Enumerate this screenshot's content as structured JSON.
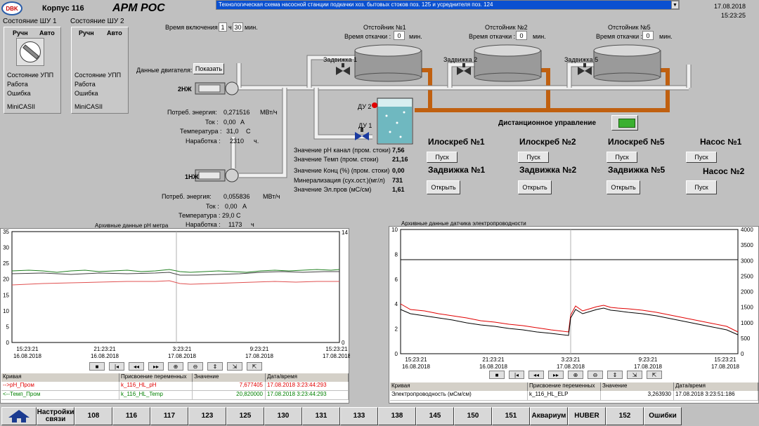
{
  "header": {
    "logo_text": "DBK",
    "building": "Корпус 116",
    "app_title": "АРМ РОС",
    "scheme_title": "Технологическая схема насосной станции подкачки хоз. бытовых стоков поз. 125 и усреднителя поз. 124",
    "date": "17.08.2018",
    "time": "15:23:25"
  },
  "shu1": {
    "title": "Состояние ШУ 1",
    "manual": "Ручн",
    "auto": "Авто",
    "upp": "Состояние УПП",
    "work": "Работа",
    "error": "Ошибка",
    "device": "MiniCASII"
  },
  "shu2": {
    "title": "Состояние ШУ 2",
    "manual": "Ручн",
    "auto": "Авто",
    "upp": "Состояние УПП",
    "work": "Работа",
    "error": "Ошибка",
    "device": "MiniCASII"
  },
  "schedule": {
    "label": "Время включения :",
    "hours": "1",
    "h": "ч",
    "minutes": "30",
    "min": "мин."
  },
  "motors": {
    "label": "Данные двигателя:",
    "show": "Показать"
  },
  "pump2": {
    "name": "2НЖ",
    "energy_label": "Потреб. энергия:",
    "energy": "0,271516",
    "energy_unit": "МВт/ч",
    "current_label": "Ток :",
    "current": "0,00",
    "current_unit": "А",
    "temp_label": "Температура :",
    "temp": "31,0",
    "temp_unit": "С",
    "hours_label": "Наработка :",
    "hours": "2310",
    "hours_unit": "ч."
  },
  "pump1": {
    "name": "1НЖ",
    "energy_label": "Потреб. энергия:",
    "energy": "0,055836",
    "energy_unit": "МВт/ч",
    "current_label": "Ток :",
    "current": "0,00",
    "current_unit": "А",
    "temp_label": "Температура :",
    "temp": "29,0",
    "temp_unit": "С",
    "hours_label": "Наработка :",
    "hours": "1173",
    "hours_unit": "ч"
  },
  "settlers": [
    {
      "title": "Отстойник №1",
      "pump_label": "Время откачки :",
      "value": "0",
      "unit": "мин.",
      "valve": "Задвижка 1"
    },
    {
      "title": "Отстойник №2",
      "pump_label": "Время откачки :",
      "value": "0",
      "unit": "мин.",
      "valve": "Задвижка 2"
    },
    {
      "title": "Отстойник №5",
      "pump_label": "Время откачки :",
      "value": "0",
      "unit": "мин.",
      "valve": "Задвижка 5"
    }
  ],
  "sensors": {
    "du2": "ДУ 2",
    "du1": "ДУ 1"
  },
  "remote": {
    "label": "Дистанционное управление"
  },
  "measurements": [
    {
      "label": "Значение pH канал (пром. стоки)",
      "value": "7,56"
    },
    {
      "label": "Значение Темп (пром. стоки)",
      "value": "21,16"
    },
    {
      "label": "Значение Конц (%) (пром. стоки)",
      "value": "0,00"
    },
    {
      "label": "Минерализация (сух.ост.)(мг/л)",
      "value": "731"
    },
    {
      "label": "Значение Эл.пров (мС/см)",
      "value": "1,61"
    }
  ],
  "controls": {
    "ilo1": "Илоскреб №1",
    "ilo2": "Илоскреб №2",
    "ilo5": "Илоскреб №5",
    "pump_n1": "Насос №1",
    "z1": "Задвижка №1",
    "z2": "Задвижка №2",
    "z5": "Задвижка №5",
    "pump_n2": "Насос №2",
    "start": "Пуск",
    "open": "Открыть"
  },
  "chart_ph": {
    "title": "Архивные данные pH метра",
    "left_ticks": [
      "35",
      "30",
      "25",
      "20",
      "15",
      "10",
      "5",
      "0"
    ],
    "right_ticks": [
      "14",
      "0"
    ],
    "x_labels": [
      {
        "t": "15:23:21",
        "d": "16.08.2018"
      },
      {
        "t": "21:23:21",
        "d": "16.08.2018"
      },
      {
        "t": "3:23:21",
        "d": "17.08.2018"
      },
      {
        "t": "9:23:21",
        "d": "17.08.2018"
      },
      {
        "t": "15:23:21",
        "d": "17.08.2018"
      }
    ],
    "legend_headers": [
      "Кривая",
      "Присвоение переменных",
      "Значение",
      "Дата/время"
    ],
    "rows": [
      {
        "curve": "-->pH_Пром",
        "var": "k_116_HL_pH",
        "value": "7,677405",
        "dt": "17.08.2018 3:23:44:293",
        "color": "#e00000"
      },
      {
        "curve": "<--Темп_Пром",
        "var": "k_116_HL_Temp",
        "value": "20,820000",
        "dt": "17.08.2018 3:23:44:293",
        "color": "#008000"
      }
    ]
  },
  "chart_elp": {
    "title": "Архивные данные датчика электропроводности",
    "left_ticks": [
      "10",
      "8",
      "6",
      "4",
      "2",
      "0"
    ],
    "right_ticks": [
      "4000",
      "3500",
      "3000",
      "2500",
      "2000",
      "1500",
      "1000",
      "500",
      "0"
    ],
    "x_labels": [
      {
        "t": "15:23:21",
        "d": "16.08.2018"
      },
      {
        "t": "21:23:21",
        "d": "16.08.2018"
      },
      {
        "t": "3:23:21",
        "d": "17.08.2018"
      },
      {
        "t": "9:23:21",
        "d": "17.08.2018"
      },
      {
        "t": "15:23:21",
        "d": "17.08.2018"
      }
    ],
    "legend_headers": [
      "Кривая",
      "Присвоение переменных",
      "Значение",
      "Дата/время"
    ],
    "rows": [
      {
        "curve": "Электропроводность (мСм/см)",
        "var": "k_116_HL_ELP",
        "value": "3,263930",
        "dt": "17.08.2018 3:23:51:186"
      }
    ]
  },
  "nav": [
    "Настройки связи",
    "108",
    "116",
    "117",
    "123",
    "125",
    "130",
    "131",
    "133",
    "138",
    "145",
    "150",
    "151",
    "Аквариум",
    "HUBER",
    "152",
    "Ошибки"
  ]
}
